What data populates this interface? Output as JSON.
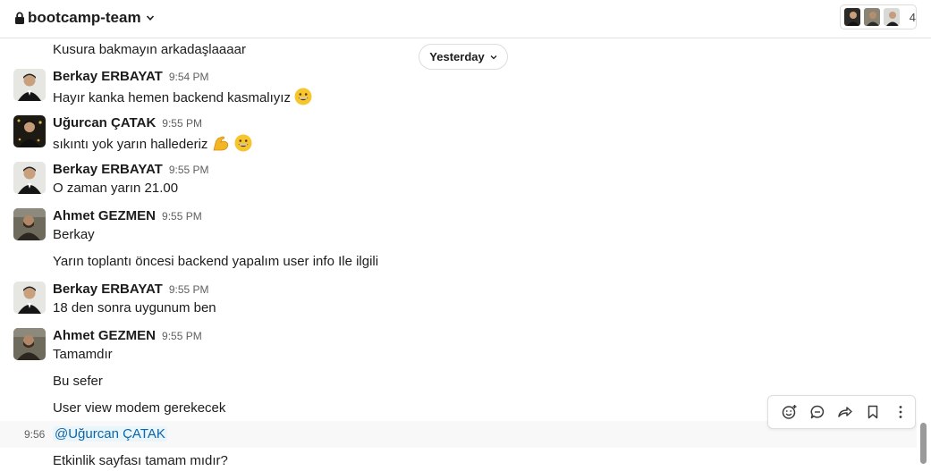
{
  "channel": {
    "name": "bootcamp-team",
    "member_count": "4"
  },
  "divider": {
    "label": "Yesterday"
  },
  "messages": [
    {
      "text": "Kusura bakmayın arkadaşlaaaar"
    },
    {
      "user": "Berkay ERBAYAT",
      "time": "9:54 PM",
      "text": "Hayır kanka hemen backend kasmalıyız",
      "emoji": "grinning-emoji"
    },
    {
      "user": "Uğurcan ÇATAK",
      "time": "9:55 PM",
      "text": "sıkıntı yok yarın hallederiz",
      "emoji": "flexed-biceps-and-grinning-emoji"
    },
    {
      "user": "Berkay ERBAYAT",
      "time": "9:55 PM",
      "text": "O zaman yarın 21.00"
    },
    {
      "user": "Ahmet GEZMEN",
      "time": "9:55 PM",
      "text": "Berkay"
    },
    {
      "text": "Yarın toplantı öncesi backend yapalım user info Ile ilgili"
    },
    {
      "user": "Berkay ERBAYAT",
      "time": "9:55 PM",
      "text": "18 den sonra uygunum ben"
    },
    {
      "user": "Ahmet GEZMEN",
      "time": "9:55 PM",
      "text": "Tamamdır"
    },
    {
      "text": "Bu sefer"
    },
    {
      "text": "User view modem gerekecek"
    },
    {
      "side_time": "9:56",
      "mention": "@Uğurcan ÇATAK"
    },
    {
      "text": "Etkinlik sayfası tamam mıdır?"
    }
  ],
  "message_actions": [
    "add-reaction-icon",
    "reply-in-thread-icon",
    "share-icon",
    "bookmark-icon",
    "more-actions-icon"
  ],
  "colors": {
    "mention": "#1264a3",
    "mention_bg": "#e8f5fa",
    "hover_row": "#f8f8f8"
  }
}
